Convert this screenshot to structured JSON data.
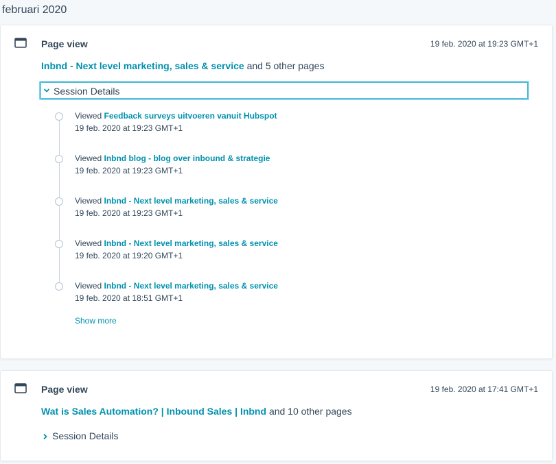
{
  "month_heading": "februari 2020",
  "cards": [
    {
      "title": "Page view",
      "timestamp": "19 feb. 2020 at 19:23 GMT+1",
      "summary_link": "Inbnd - Next level marketing, sales & service",
      "summary_suffix": "and 5 other pages",
      "session_label": "Session Details",
      "expanded": true,
      "timeline": [
        {
          "prefix": "Viewed",
          "page": "Feedback surveys uitvoeren vanuit Hubspot",
          "time": "19 feb. 2020 at 19:23 GMT+1"
        },
        {
          "prefix": "Viewed",
          "page": "Inbnd blog - blog over inbound & strategie",
          "time": "19 feb. 2020 at 19:23 GMT+1"
        },
        {
          "prefix": "Viewed",
          "page": "Inbnd - Next level marketing, sales & service",
          "time": "19 feb. 2020 at 19:23 GMT+1"
        },
        {
          "prefix": "Viewed",
          "page": "Inbnd - Next level marketing, sales & service",
          "time": "19 feb. 2020 at 19:20 GMT+1"
        },
        {
          "prefix": "Viewed",
          "page": "Inbnd - Next level marketing, sales & service",
          "time": "19 feb. 2020 at 18:51 GMT+1"
        }
      ],
      "show_more_label": "Show more"
    },
    {
      "title": "Page view",
      "timestamp": "19 feb. 2020 at 17:41 GMT+1",
      "summary_link": "Wat is Sales Automation? | Inbound Sales | Inbnd",
      "summary_suffix": "and 10 other pages",
      "session_label": "Session Details",
      "expanded": false
    }
  ],
  "icons": {
    "card_icon": "browser-window-icon",
    "expanded_chevron": "chevron-down-icon",
    "collapsed_chevron": "chevron-right-icon"
  },
  "colors": {
    "link": "#0091ae",
    "text": "#33475b",
    "focus_outline": "#7fd1e8",
    "background": "#f5f8fa"
  }
}
